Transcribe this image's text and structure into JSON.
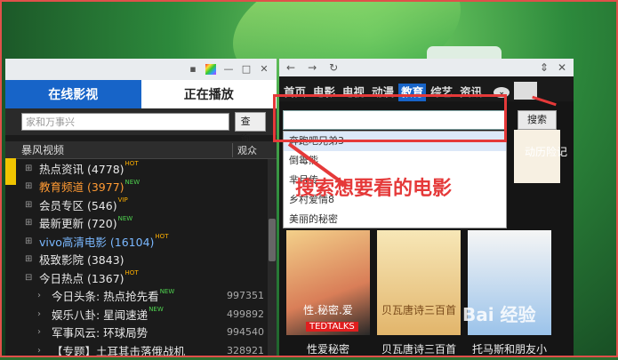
{
  "left": {
    "tabs": [
      "在线影视",
      "正在播放"
    ],
    "search_placeholder": "家和万事兴",
    "search_button": "查询",
    "tree_header": "暴风视频",
    "sort_label": "观众",
    "items": [
      {
        "label": "热点资讯 (4778)",
        "badge": "HOT"
      },
      {
        "label": "教育频道 (3977)",
        "badge": "NEW",
        "color": "#ff9a33"
      },
      {
        "label": "会员专区 (546)",
        "badge": "VIP"
      },
      {
        "label": "最新更新 (720)",
        "badge": "NEW"
      },
      {
        "label": "vivo高清电影 (16104)",
        "badge": "HOT",
        "color": "#7ab8ff"
      },
      {
        "label": "极致影院 (3843)",
        "badge": ""
      },
      {
        "label": "今日热点 (1367)",
        "badge": "HOT"
      }
    ],
    "subitems": [
      {
        "label": "今日头条: 热点抢先看",
        "badge": "NEW",
        "num": "997351"
      },
      {
        "label": "娱乐八卦: 星闻速递",
        "badge": "NEW",
        "num": "499892"
      },
      {
        "label": "军事风云: 环球局势",
        "badge": "",
        "num": "994540"
      },
      {
        "label": "【专题】土耳其击落俄战机",
        "badge": "",
        "num": "328921"
      }
    ]
  },
  "right": {
    "nav": [
      "首页",
      "电影",
      "电视",
      "动漫",
      "教育",
      "综艺",
      "资讯"
    ],
    "search_button": "搜索",
    "dropdown": [
      "奔跑吧兄弟3",
      "倒霉熊",
      "芈月传",
      "乡村爱情8",
      "美丽的秘密"
    ],
    "posters": [
      {
        "text": "性.秘密.爱",
        "tag": "TEDTALKS"
      },
      {
        "text": "贝瓦唐诗三百首",
        "tag": ""
      },
      {
        "text": "",
        "tag": ""
      }
    ],
    "captions": [
      "性爱秘密",
      "贝瓦唐诗三百首",
      "托马斯和朋友小"
    ],
    "side_caption": "动历险记"
  },
  "annotation": "搜索想要看的电影",
  "watermark": "Bai 经验"
}
